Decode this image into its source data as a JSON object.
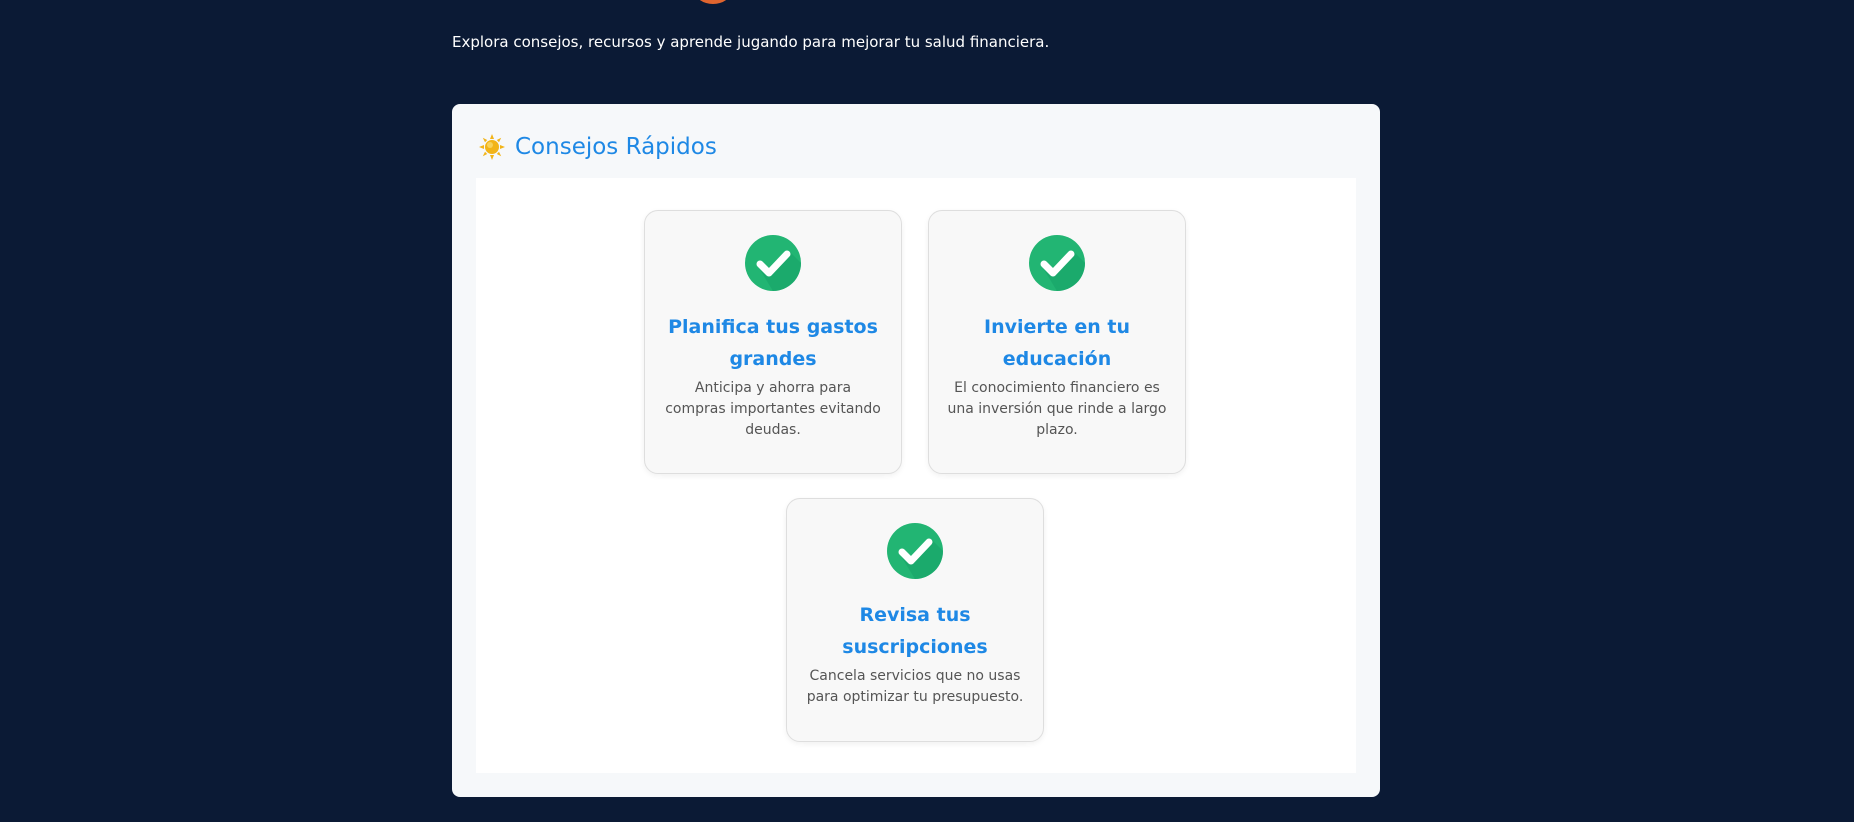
{
  "intro_text": "Explora consejos, recursos y aprende jugando para mejorar tu salud financiera.",
  "section": {
    "icon": "sun-icon",
    "title": "Consejos Rápidos"
  },
  "tips": [
    {
      "icon": "check-circle-icon",
      "title": "Planifica tus gastos grandes",
      "description": "Anticipa y ahorra para compras importantes evitando deudas."
    },
    {
      "icon": "check-circle-icon",
      "title": "Invierte en tu educación",
      "description": "El conocimiento financiero es una inversión que rinde a largo plazo."
    },
    {
      "icon": "check-circle-icon",
      "title": "Revisa tus suscripciones",
      "description": "Cancela servicios que no usas para optimizar tu presupuesto."
    }
  ],
  "colors": {
    "background": "#0b1a35",
    "accent": "#1e88e5",
    "check": "#22b573",
    "brand_orange": "#e0652f"
  }
}
